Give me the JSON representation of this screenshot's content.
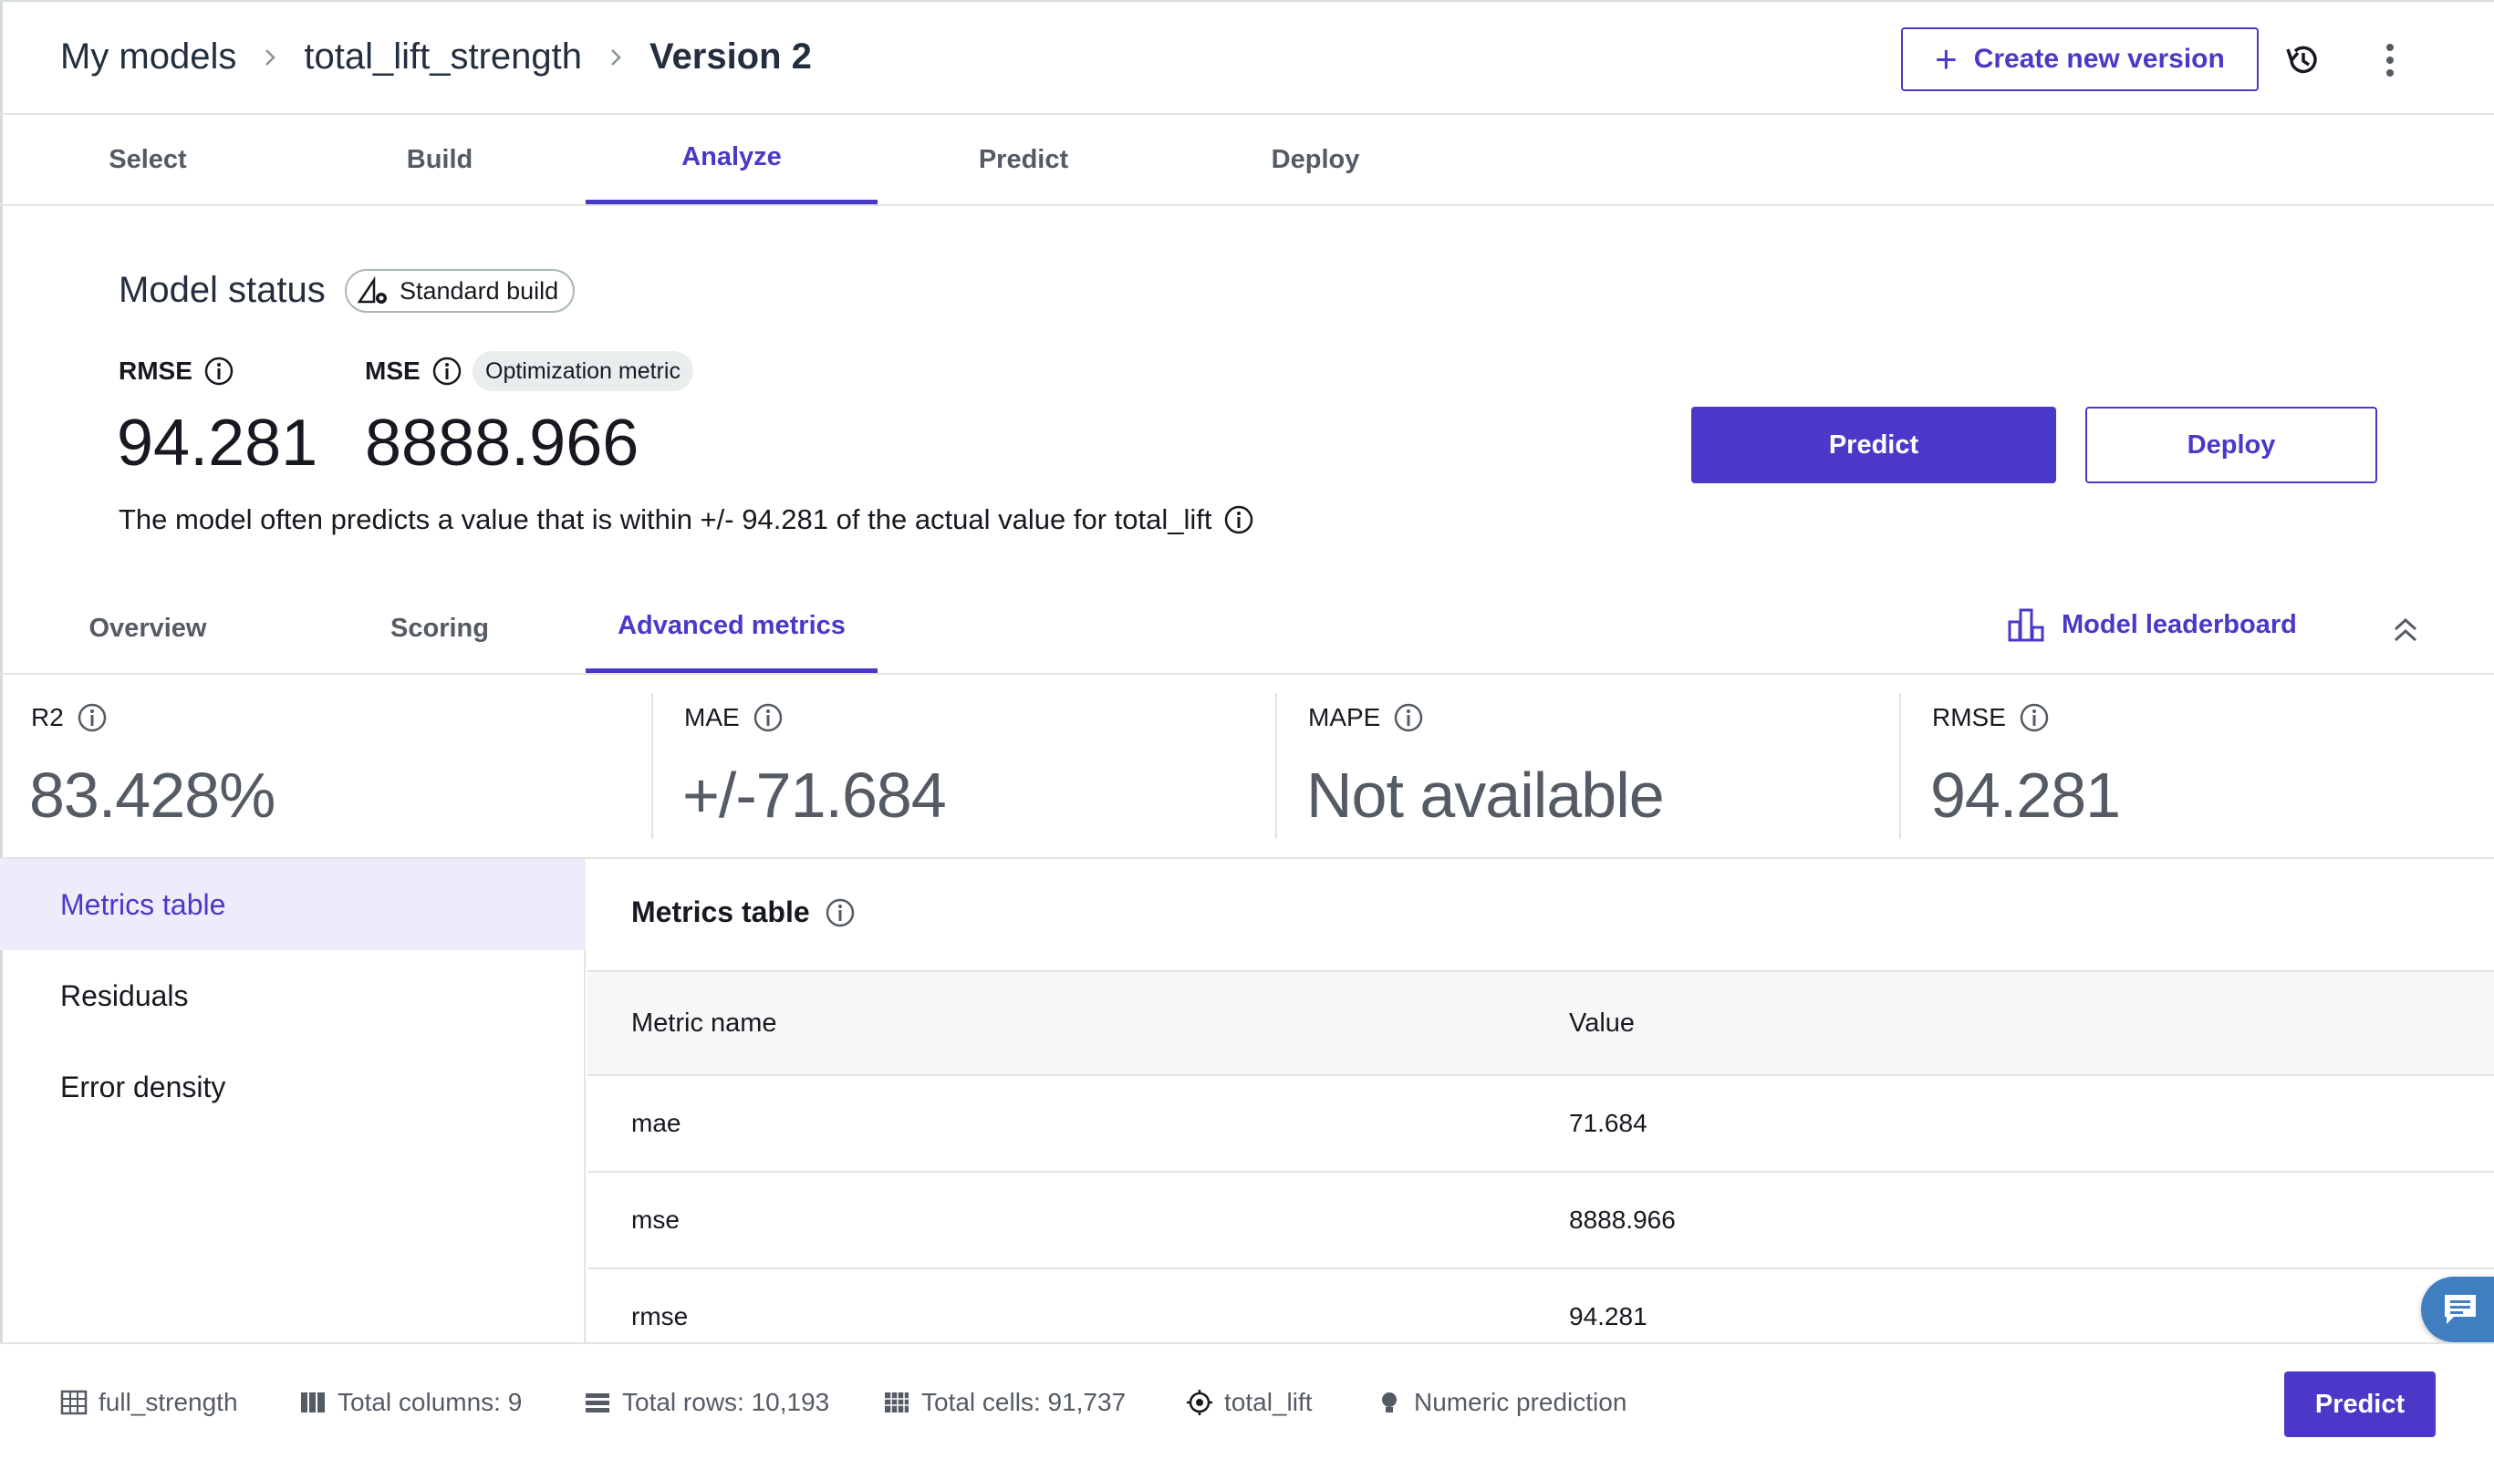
{
  "breadcrumb": {
    "items": [
      "My models",
      "total_lift_strength",
      "Version 2"
    ]
  },
  "header": {
    "create_version_label": "Create new version"
  },
  "main_tabs": [
    "Select",
    "Build",
    "Analyze",
    "Predict",
    "Deploy"
  ],
  "main_tab_active": "Analyze",
  "model_status": {
    "title": "Model status",
    "build_badge": "Standard build",
    "rmse_label": "RMSE",
    "rmse_value": "94.281",
    "mse_label": "MSE",
    "mse_badge": "Optimization metric",
    "mse_value": "8888.966",
    "description": "The model often predicts a value that is within +/- 94.281 of the actual value for total_lift",
    "predict_button": "Predict",
    "deploy_button": "Deploy"
  },
  "sub_tabs": [
    "Overview",
    "Scoring",
    "Advanced metrics"
  ],
  "sub_tab_active": "Advanced metrics",
  "leaderboard_label": "Model leaderboard",
  "metric_cards": [
    {
      "label": "R2",
      "value": "83.428%"
    },
    {
      "label": "MAE",
      "value": "+/-71.684"
    },
    {
      "label": "MAPE",
      "value": "Not available"
    },
    {
      "label": "RMSE",
      "value": "94.281"
    }
  ],
  "side_nav": {
    "items": [
      "Metrics table",
      "Residuals",
      "Error density"
    ],
    "active": "Metrics table"
  },
  "metrics_table": {
    "title": "Metrics table",
    "columns": [
      "Metric name",
      "Value"
    ],
    "rows": [
      {
        "name": "mae",
        "value": "71.684"
      },
      {
        "name": "mse",
        "value": "8888.966"
      },
      {
        "name": "rmse",
        "value": "94.281"
      }
    ]
  },
  "footer": {
    "dataset": "full_strength",
    "total_columns": "Total columns: 9",
    "total_rows": "Total rows: 10,193",
    "total_cells": "Total cells: 91,737",
    "target": "total_lift",
    "problem_type": "Numeric prediction",
    "predict_button": "Predict"
  },
  "colors": {
    "accent": "#4a39c9",
    "active_nav_bg": "#eeecfb",
    "chat_bubble": "#3f7fc0"
  },
  "icons": [
    "chevron-right-icon",
    "plus-icon",
    "history-icon",
    "kebab-icon",
    "build-icon",
    "info-icon",
    "leaderboard-icon",
    "collapse-icon",
    "chat-icon",
    "table-icon",
    "columns-icon",
    "rows-icon",
    "cells-icon",
    "target-icon",
    "bulb-icon"
  ]
}
